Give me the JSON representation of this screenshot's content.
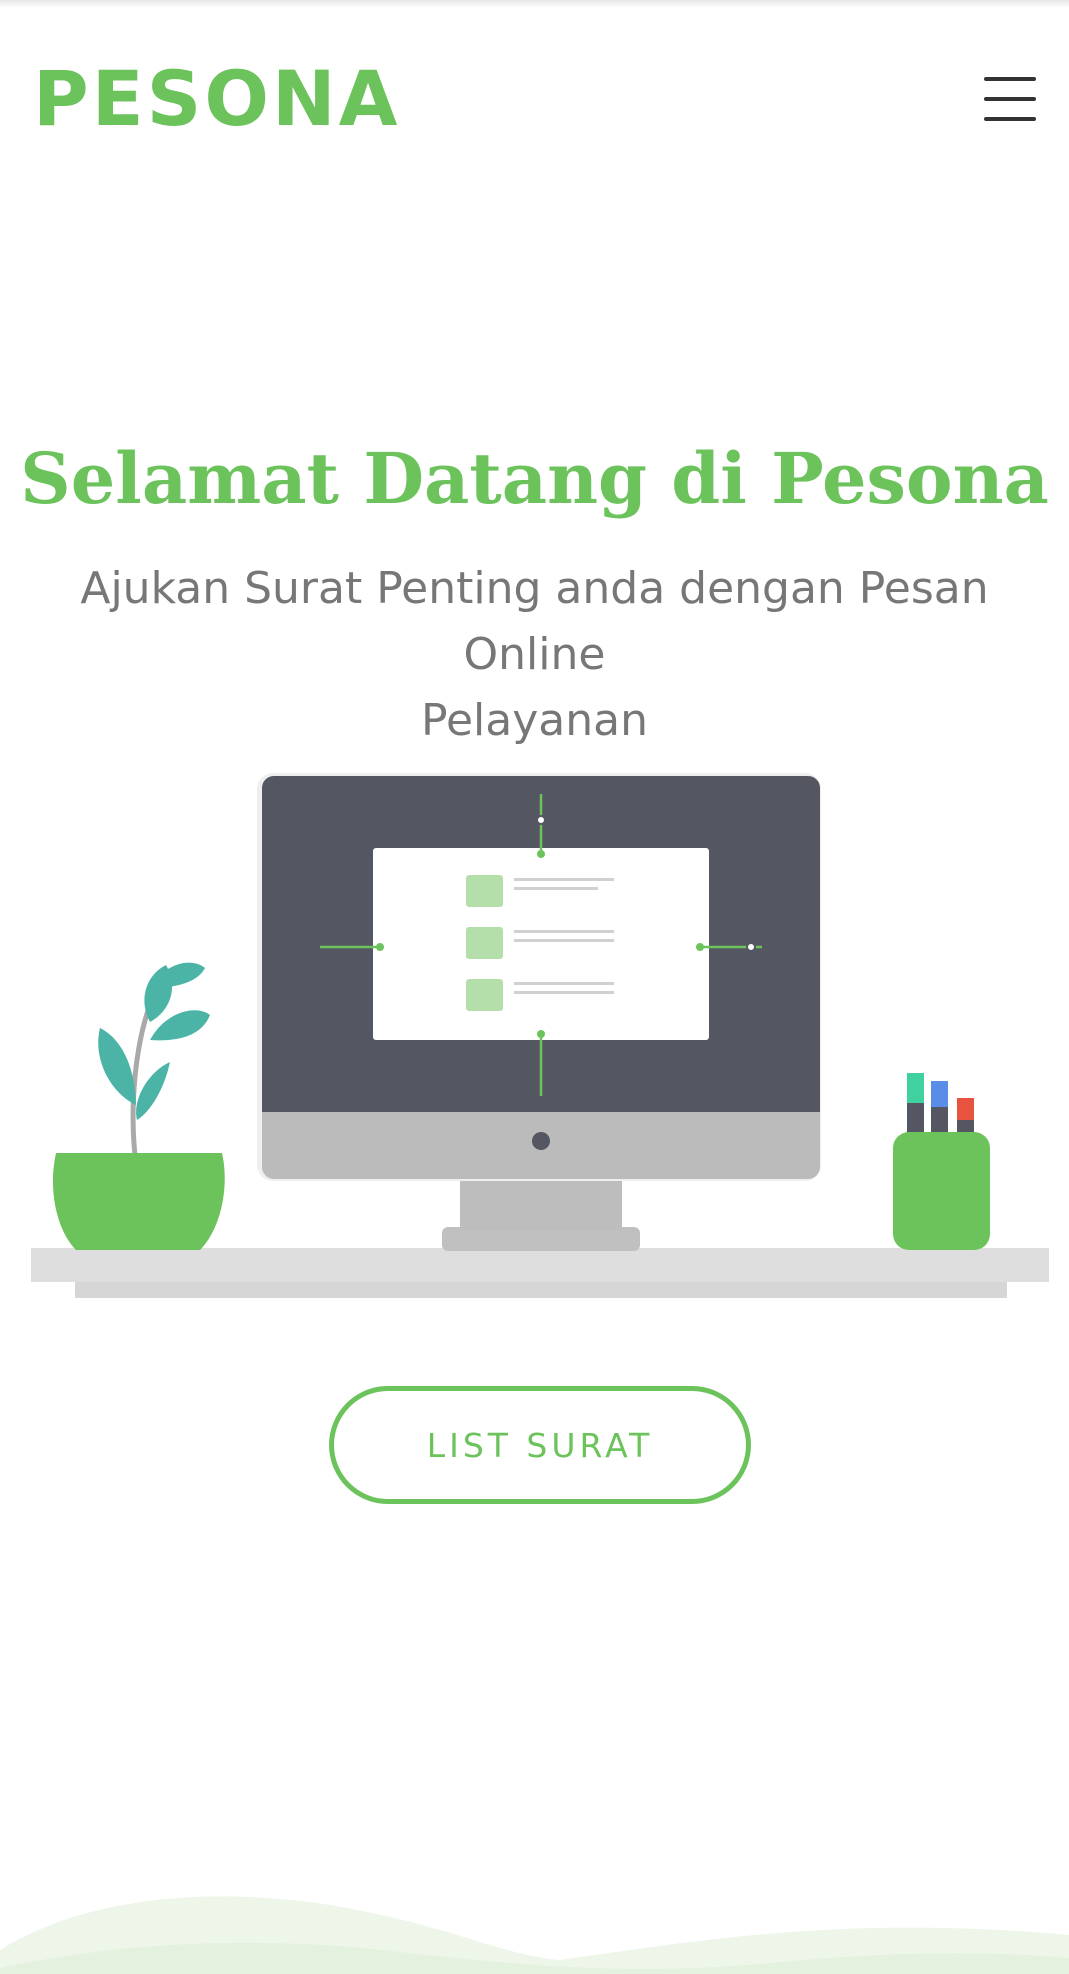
{
  "header": {
    "brand": "PESONA",
    "menu_icon": "hamburger-menu-icon"
  },
  "hero": {
    "title": "Selamat Datang di Pesona",
    "subtitle_line1": "Ajukan Surat Penting anda dengan Pesan Online",
    "subtitle_line2": "Pelayanan",
    "illustration_icon": "desk-computer-illustration"
  },
  "actions": {
    "list_surat_label": "LIST SURAT"
  },
  "colors": {
    "accent": "#6cc35c",
    "subtitle": "#777777",
    "monitor": "#545661"
  }
}
